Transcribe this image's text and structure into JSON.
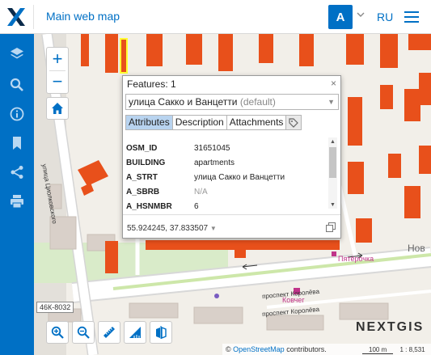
{
  "header": {
    "title": "Main web map",
    "user_initial": "A",
    "language": "RU",
    "logo_icon": "nextgis-x-logo",
    "menu_icon": "hamburger-icon"
  },
  "sidebar": {
    "items": [
      {
        "name": "layers",
        "icon": "layers-icon"
      },
      {
        "name": "search",
        "icon": "search-icon"
      },
      {
        "name": "info",
        "icon": "info-icon"
      },
      {
        "name": "bookmarks",
        "icon": "bookmark-icon"
      },
      {
        "name": "share",
        "icon": "share-icon"
      },
      {
        "name": "print",
        "icon": "print-icon"
      }
    ]
  },
  "map": {
    "zoom_in": "+",
    "zoom_out": "−",
    "road_labels": {
      "tsiolkovsky": "улица Циолковского",
      "korolev_1": "проспект Королёва",
      "korolev_2": "проспект Королёва",
      "road_number": "46К-8032"
    },
    "poi": {
      "pyaterochka": "Пятёрочка",
      "kovcheg": "Ковчег",
      "novy_fragment": "Нов"
    },
    "branding": "NEXTGIS",
    "attribution": {
      "prefix": "©",
      "link": "OpenStreetMap",
      "suffix": "contributors."
    },
    "scale": {
      "distance": "100 m",
      "ratio": "1 : 8,531"
    }
  },
  "popup": {
    "title": "Features: 1",
    "close": "×",
    "feature_name": "улица Сакко и Ванцетти",
    "feature_suffix": "(default)",
    "tabs": [
      "Attributes",
      "Description",
      "Attachments"
    ],
    "active_tab": "Attributes",
    "attributes": [
      {
        "key": "OSM_ID",
        "value": "31651045"
      },
      {
        "key": "BUILDING",
        "value": "apartments"
      },
      {
        "key": "A_STRT",
        "value": "улица Сакко и Ванцетти"
      },
      {
        "key": "A_SBRB",
        "value": "N/A"
      },
      {
        "key": "A_HSNMBR",
        "value": "6"
      }
    ],
    "coordinates": "55.924245, 37.833507"
  },
  "colors": {
    "accent": "#0070c5",
    "building": "#e8501b",
    "highlight": "#ffff33"
  }
}
